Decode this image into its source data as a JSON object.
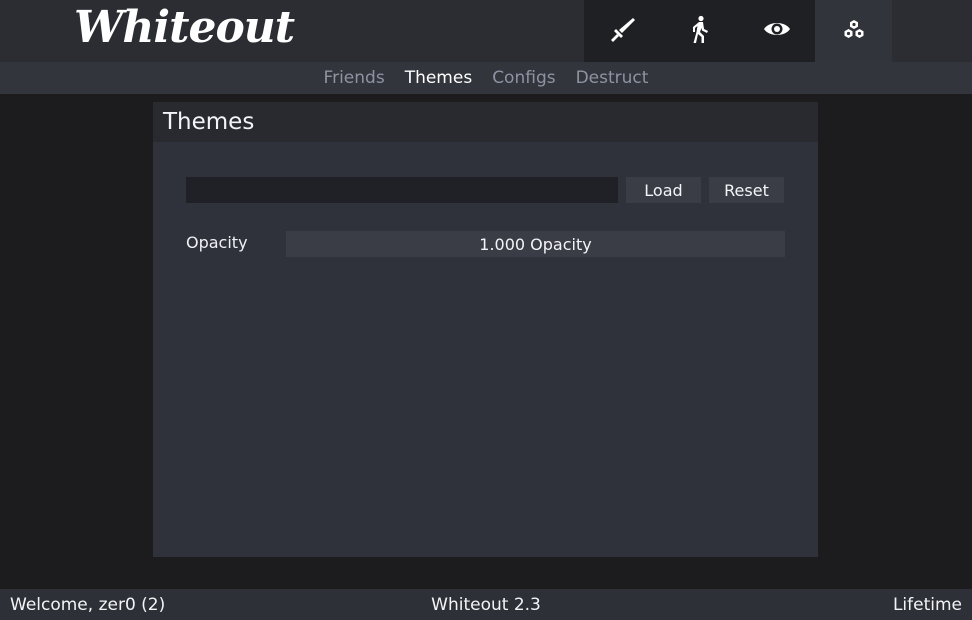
{
  "header": {
    "logo": "Whiteout",
    "icon_tabs": [
      {
        "name": "sword-icon",
        "active": false
      },
      {
        "name": "walking-person-icon",
        "active": false
      },
      {
        "name": "eye-icon",
        "active": false
      },
      {
        "name": "cubes-icon",
        "active": true
      }
    ]
  },
  "subnav": {
    "items": [
      "Friends",
      "Themes",
      "Configs",
      "Destruct"
    ],
    "active": "Themes"
  },
  "panel": {
    "title": "Themes",
    "theme_input": {
      "value": "",
      "placeholder": ""
    },
    "load_label": "Load",
    "reset_label": "Reset",
    "opacity_label": "Opacity",
    "opacity_value": "1.000 Opacity",
    "opacity_level": 1.0
  },
  "footer": {
    "welcome": "Welcome, zer0 (2)",
    "version": "Whiteout 2.3",
    "license": "Lifetime"
  },
  "colors": {
    "background": "#1c1c1e",
    "header": "#2b2d33",
    "panel": "#2f323a",
    "active_text": "#ffffff",
    "inactive_text": "#8e93a2"
  }
}
